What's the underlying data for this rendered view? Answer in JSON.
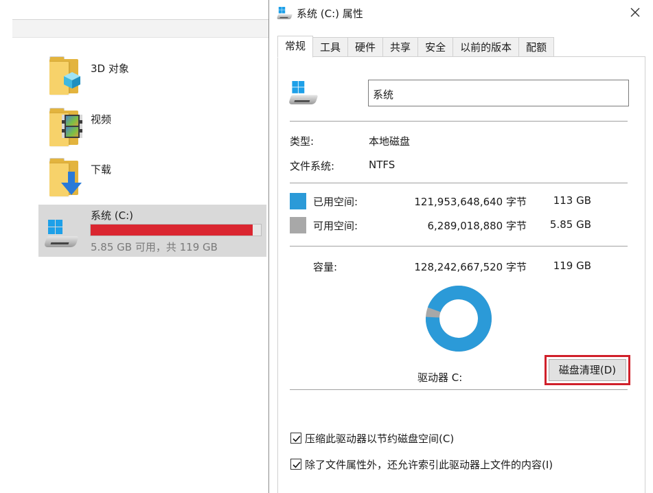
{
  "explorer": {
    "items": [
      {
        "label": "3D 对象",
        "icon": "3d-objects-folder-icon"
      },
      {
        "label": "视频",
        "icon": "videos-folder-icon"
      },
      {
        "label": "下载",
        "icon": "downloads-folder-icon"
      }
    ],
    "drive": {
      "label": "系统 (C:)",
      "free_text": "5.85 GB 可用，共 119 GB",
      "used_fraction": 0.951,
      "bar_color": "#da2630"
    }
  },
  "dialog": {
    "title": "系统 (C:) 属性",
    "tabs": [
      "常规",
      "工具",
      "硬件",
      "共享",
      "安全",
      "以前的版本",
      "配额"
    ],
    "active_tab": "常规",
    "drive_name_value": "系统",
    "type_label": "类型:",
    "type_value": "本地磁盘",
    "fs_label": "文件系统:",
    "fs_value": "NTFS",
    "used_label": "已用空间:",
    "used_bytes": "121,953,648,640 字节",
    "used_size": "113 GB",
    "used_color": "#2b9ad8",
    "free_label": "可用空间:",
    "free_bytes": "6,289,018,880 字节",
    "free_size": "5.85 GB",
    "free_color": "#a8a8a8",
    "capacity_label": "容量:",
    "capacity_bytes": "128,242,667,520 字节",
    "capacity_size": "119 GB",
    "used_fraction": 0.951,
    "drive_caption": "驱动器 C:",
    "cleanup_button": "磁盘清理(D)",
    "highlight_color": "#d0202a",
    "compress_option": {
      "label": "压缩此驱动器以节约磁盘空间(C)",
      "checked": true
    },
    "index_option": {
      "label": "除了文件属性外，还允许索引此驱动器上文件的内容(I)",
      "checked": true
    }
  }
}
